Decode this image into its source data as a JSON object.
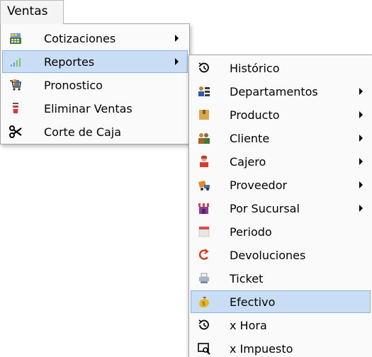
{
  "menubar": {
    "label": "Ventas"
  },
  "main_menu": {
    "items": [
      {
        "label": "Cotizaciones",
        "icon": "cash-register-icon",
        "has_submenu": true,
        "selected": false
      },
      {
        "label": "Reportes",
        "icon": "bar-chart-icon",
        "has_submenu": true,
        "selected": true
      },
      {
        "label": "Pronostico",
        "icon": "shopping-cart-icon",
        "has_submenu": false,
        "selected": false
      },
      {
        "label": "Eliminar Ventas",
        "icon": "cup-delete-icon",
        "has_submenu": false,
        "selected": false
      },
      {
        "label": "Corte de Caja",
        "icon": "scissors-icon",
        "has_submenu": false,
        "selected": false
      }
    ]
  },
  "sub_menu": {
    "items": [
      {
        "label": "Histórico",
        "icon": "history-icon",
        "has_submenu": false,
        "selected": false
      },
      {
        "label": "Departamentos",
        "icon": "departments-icon",
        "has_submenu": true,
        "selected": false
      },
      {
        "label": "Producto",
        "icon": "product-box-icon",
        "has_submenu": true,
        "selected": false
      },
      {
        "label": "Cliente",
        "icon": "clients-icon",
        "has_submenu": true,
        "selected": false
      },
      {
        "label": "Cajero",
        "icon": "cashier-icon",
        "has_submenu": true,
        "selected": false
      },
      {
        "label": "Proveedor",
        "icon": "delivery-truck-icon",
        "has_submenu": true,
        "selected": false
      },
      {
        "label": "Por Sucursal",
        "icon": "store-icon",
        "has_submenu": true,
        "selected": false
      },
      {
        "label": "Periodo",
        "icon": "calendar-icon",
        "has_submenu": false,
        "selected": false
      },
      {
        "label": "Devoluciones",
        "icon": "return-arrow-icon",
        "has_submenu": false,
        "selected": false
      },
      {
        "label": "Ticket",
        "icon": "receipt-printer-icon",
        "has_submenu": false,
        "selected": false
      },
      {
        "label": "Efectivo",
        "icon": "money-bag-icon",
        "has_submenu": false,
        "selected": true
      },
      {
        "label": "x Hora",
        "icon": "history-icon",
        "has_submenu": false,
        "selected": false
      },
      {
        "label": "x Impuesto",
        "icon": "tax-search-icon",
        "has_submenu": false,
        "selected": false
      }
    ]
  },
  "colors": {
    "selection_fill": "#c9def5",
    "selection_border": "#8cb3dc"
  }
}
